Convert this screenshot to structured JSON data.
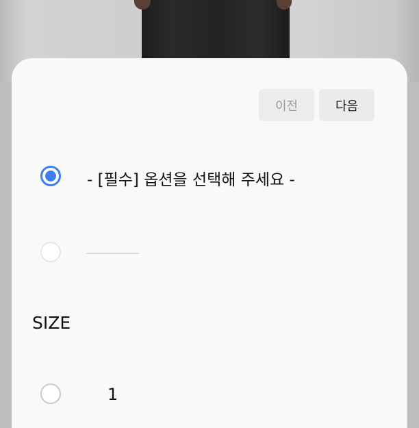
{
  "nav": {
    "prev_label": "이전",
    "next_label": "다음"
  },
  "options": [
    {
      "label": "- [필수] 옵션을 선택해 주세요 -",
      "selected": true
    },
    {
      "label": "-------------------",
      "selected": false
    }
  ],
  "size_section": {
    "title": "SIZE",
    "options": [
      {
        "label": "1",
        "selected": false
      }
    ]
  },
  "colors": {
    "accent": "#3d7ef0"
  }
}
